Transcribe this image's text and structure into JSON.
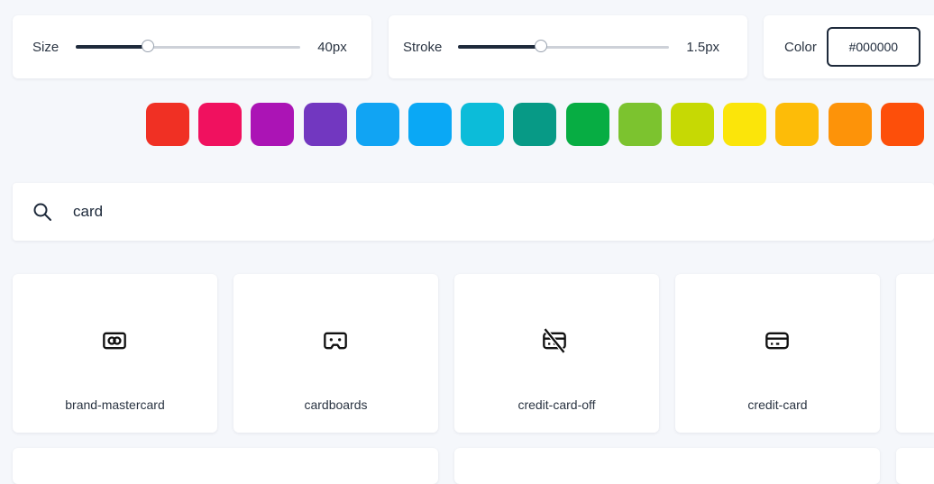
{
  "controls": {
    "size": {
      "label": "Size",
      "value": "40px",
      "level": 0.32
    },
    "stroke": {
      "label": "Stroke",
      "value": "1.5px",
      "level": 0.39
    },
    "color": {
      "label": "Color",
      "value": "#000000"
    }
  },
  "swatches": [
    {
      "name": "red",
      "color": "#f03024"
    },
    {
      "name": "pink",
      "color": "#f0115f"
    },
    {
      "name": "grape",
      "color": "#ab14b5"
    },
    {
      "name": "violet",
      "color": "#7237c0"
    },
    {
      "name": "blue",
      "color": "#11a4f3"
    },
    {
      "name": "azure",
      "color": "#0aa8f5"
    },
    {
      "name": "cyan",
      "color": "#0cbcd9"
    },
    {
      "name": "teal",
      "color": "#079a86"
    },
    {
      "name": "green",
      "color": "#07ad43"
    },
    {
      "name": "lime",
      "color": "#7cc32f"
    },
    {
      "name": "lime-yellow",
      "color": "#c6d904"
    },
    {
      "name": "yellow",
      "color": "#fbe50a"
    },
    {
      "name": "amber",
      "color": "#fdbc08"
    },
    {
      "name": "orange",
      "color": "#fd9309"
    },
    {
      "name": "red-orange",
      "color": "#fd4f0a"
    }
  ],
  "search": {
    "query": "card",
    "icon": "search-icon"
  },
  "icons": [
    {
      "label": "brand-mastercard",
      "icon": "brand-mastercard-icon"
    },
    {
      "label": "cardboards",
      "icon": "cardboards-icon"
    },
    {
      "label": "credit-card-off",
      "icon": "credit-card-off-icon"
    },
    {
      "label": "credit-card",
      "icon": "credit-card-icon"
    },
    {
      "label": "",
      "icon": ""
    }
  ]
}
